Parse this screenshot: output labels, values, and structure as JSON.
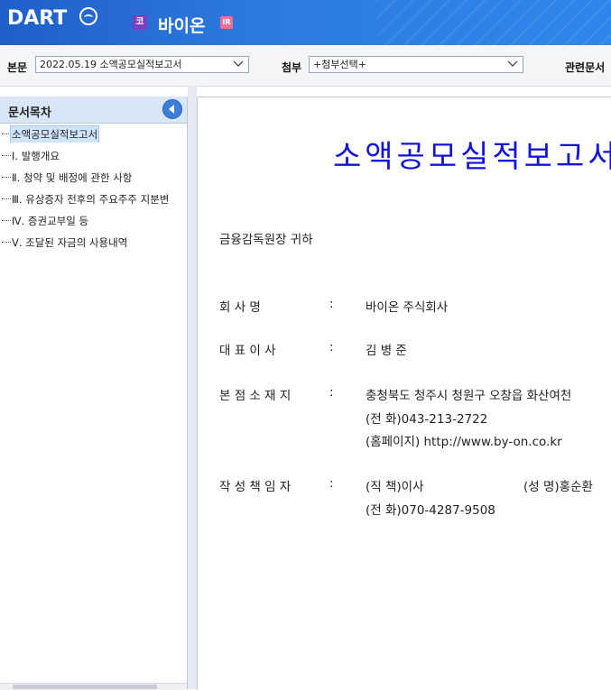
{
  "header": {
    "logo": "DART",
    "company_badge": "코",
    "company": "바이온",
    "ir_badge": "IR",
    "accent": "#2e7be0"
  },
  "toolbar": {
    "body_label": "본문",
    "body_select": "2022.05.19  소액공모실적보고서",
    "attach_label": "첨부",
    "attach_select": "+첨부선택+",
    "related_label": "관련문서"
  },
  "sidebar": {
    "title": "문서목차",
    "items": [
      {
        "label": "소액공모실적보고서"
      },
      {
        "label": "Ⅰ. 발행개요"
      },
      {
        "label": "Ⅱ. 청약 및 배정에 관한 사항"
      },
      {
        "label": "Ⅲ. 유상증자 전후의 주요주주 지분변"
      },
      {
        "label": "Ⅳ. 증권교부일 등"
      },
      {
        "label": "Ⅴ. 조달된 자금의 사용내역"
      }
    ]
  },
  "document": {
    "title": "소액공모실적보고서",
    "title_color": "#1313d8",
    "addressee": "금융감독원장 귀하",
    "company_name_label": "회     사     명",
    "company_name_value": "바이온 주식회사",
    "ceo_label": "대  표   이  사",
    "ceo_value": "김 병 준",
    "hq_label": "본 점 소 재 지",
    "hq_value": "충청북도 청주시 청원구 오창읍 화산여천",
    "hq_phone": "(전   화)043-213-2722",
    "hq_homepage": "(홈페이지) http://www.by-on.co.kr",
    "preparer_label": "작 성 책 임 자",
    "preparer_title": "(직   책)이사",
    "preparer_name": "(성   명)홍순환",
    "preparer_phone": "(전   화)070-4287-9508",
    "separator": ":"
  }
}
